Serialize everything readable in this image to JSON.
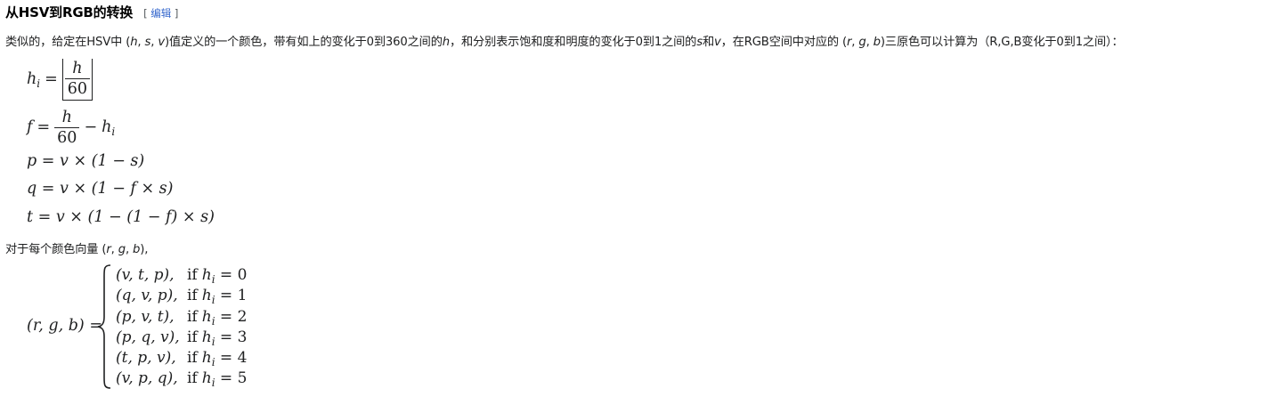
{
  "section": {
    "title": "从HSV到RGB的转换",
    "edit_bracket_open": "[",
    "edit_label": "编辑",
    "edit_bracket_close": "]"
  },
  "intro": {
    "t1": "类似的，给定在HSV中 (",
    "h": "h",
    "c1": ", ",
    "s": "s",
    "c2": ", ",
    "v": "v",
    "t2": ")值定义的一个颜色，带有如上的变化于0到360之间的",
    "h2": "h",
    "t3": "，和分别表示饱和度和明度的变化于0到1之间的",
    "s2": "s",
    "t4": "和",
    "v2": "v",
    "t5": "，在RGB空间中对应的 (",
    "r": "r",
    "c3": ", ",
    "g": "g",
    "c4": ", ",
    "b": "b",
    "t6": ")三原色可以计算为（R,G,B变化于0到1之间）："
  },
  "formulas": {
    "hi": {
      "lhs": "h",
      "sub": "i",
      "eq": "=",
      "num": "h",
      "den": "60"
    },
    "f": {
      "lhs": "f",
      "eq": "=",
      "num": "h",
      "den": "60",
      "minus": "−",
      "rhs": "h",
      "sub": "i"
    },
    "p": {
      "text": "p = v × (1 − s)"
    },
    "q": {
      "text": "q = v × (1 − f × s)"
    },
    "t": {
      "text": "t = v × (1 − (1 − f) × s)"
    }
  },
  "vector_line": {
    "t1": "对于每个颜色向量 (",
    "r": "r",
    "c1": ", ",
    "g": "g",
    "c2": ", ",
    "b": "b",
    "t2": "),"
  },
  "cases": {
    "lhs": "(r, g, b) =",
    "rows": [
      {
        "tuple": "(v, t, p),",
        "if": "if",
        "var": "h",
        "sub": "i",
        "eq": " = 0"
      },
      {
        "tuple": "(q, v, p),",
        "if": "if",
        "var": "h",
        "sub": "i",
        "eq": " = 1"
      },
      {
        "tuple": "(p, v, t),",
        "if": "if",
        "var": "h",
        "sub": "i",
        "eq": " = 2"
      },
      {
        "tuple": "(p, q, v),",
        "if": "if",
        "var": "h",
        "sub": "i",
        "eq": " = 3"
      },
      {
        "tuple": "(t, p, v),",
        "if": "if",
        "var": "h",
        "sub": "i",
        "eq": " = 4"
      },
      {
        "tuple": "(v, p, q),",
        "if": "if",
        "var": "h",
        "sub": "i",
        "eq": " = 5"
      }
    ]
  }
}
